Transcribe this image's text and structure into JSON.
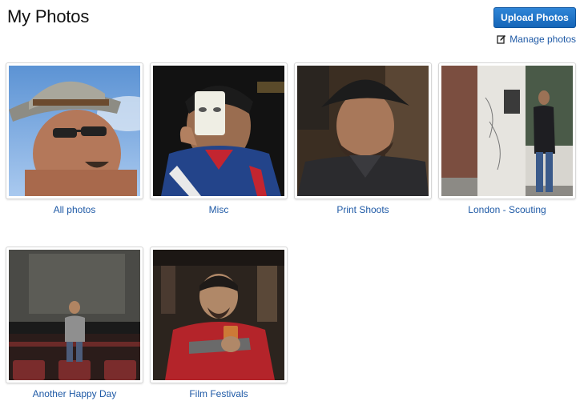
{
  "header": {
    "title": "My Photos",
    "upload_label": "Upload Photos",
    "manage_label": "Manage photos"
  },
  "colors": {
    "accent": "#1a6fc6",
    "link": "#1f5aa6"
  },
  "albums": [
    {
      "label": "All photos"
    },
    {
      "label": "Misc"
    },
    {
      "label": "Print Shoots"
    },
    {
      "label": "London - Scouting"
    },
    {
      "label": "Another Happy Day"
    },
    {
      "label": "Film Festivals"
    }
  ]
}
